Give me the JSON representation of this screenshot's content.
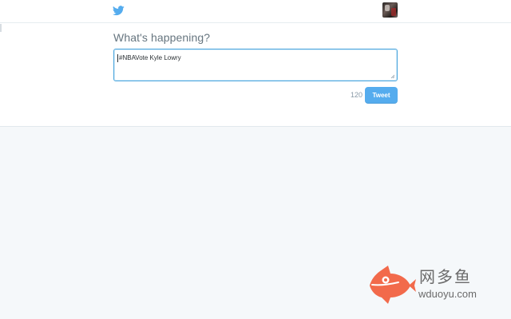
{
  "header": {
    "logo_icon": "twitter-bird-icon",
    "avatar_icon": "user-avatar"
  },
  "composer": {
    "title": "What's happening?",
    "text": "#NBAVote Kyle Lowry",
    "char_count": "120",
    "tweet_button": "Tweet"
  },
  "watermark": {
    "logo_icon": "fish-icon",
    "cn_text": "网多鱼",
    "url": "wduoyu.com"
  },
  "colors": {
    "accent": "#55acee",
    "input_border": "#4da7de",
    "background": "#f5f8fa",
    "watermark_orange": "#f26a4b"
  }
}
